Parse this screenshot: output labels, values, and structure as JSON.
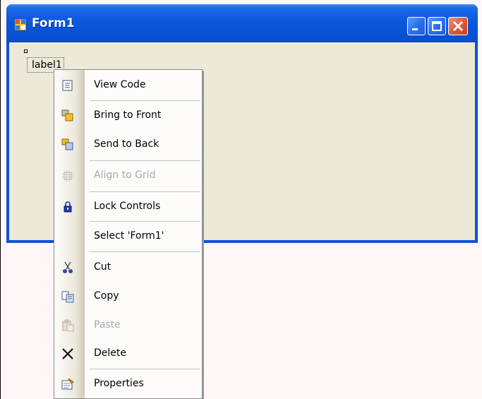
{
  "window": {
    "title": "Form1",
    "controls": [
      "minimize",
      "maximize",
      "close"
    ]
  },
  "form": {
    "label": "label1"
  },
  "context_menu": {
    "items": [
      {
        "label": "View Code",
        "icon": "view-code-icon",
        "enabled": true
      },
      {
        "label": "Bring to Front",
        "icon": "bring-to-front-icon",
        "enabled": true
      },
      {
        "label": "Send to Back",
        "icon": "send-to-back-icon",
        "enabled": true
      },
      {
        "label": "Align to Grid",
        "icon": "align-to-grid-icon",
        "enabled": false
      },
      {
        "label": "Lock Controls",
        "icon": "lock-icon",
        "enabled": true
      },
      {
        "label": "Select 'Form1'",
        "icon": "",
        "enabled": true
      },
      {
        "label": "Cut",
        "icon": "scissors-icon",
        "enabled": true
      },
      {
        "label": "Copy",
        "icon": "copy-icon",
        "enabled": true
      },
      {
        "label": "Paste",
        "icon": "paste-icon",
        "enabled": false
      },
      {
        "label": "Delete",
        "icon": "delete-x-icon",
        "enabled": true
      },
      {
        "label": "Properties",
        "icon": "properties-icon",
        "enabled": true
      }
    ]
  },
  "colors": {
    "titlebar": "#0a53d8",
    "client": "#ece9d8",
    "designer": "#fff7f7",
    "disabled_text": "#a8a8a8"
  }
}
